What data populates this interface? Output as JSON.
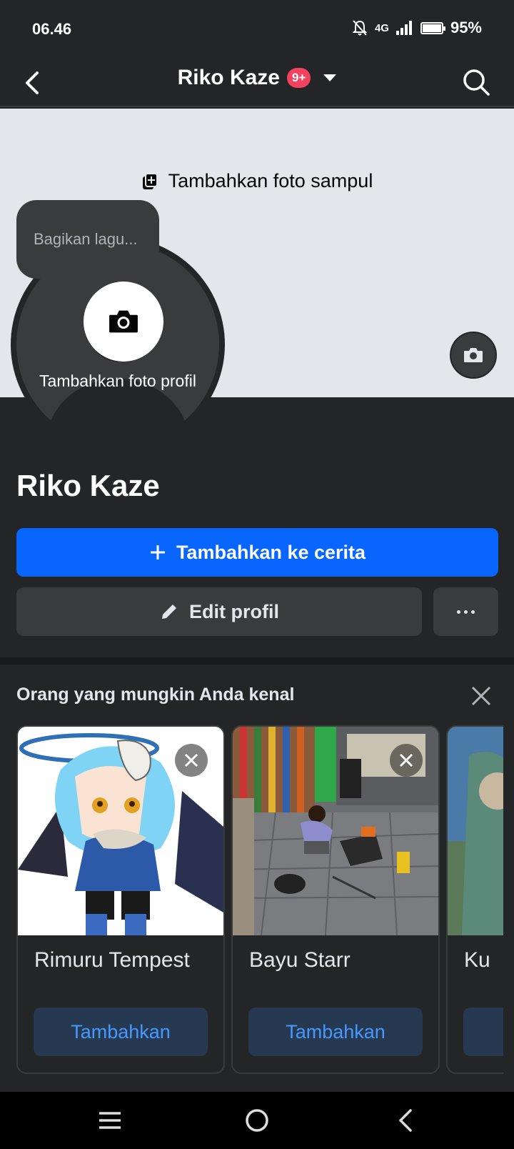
{
  "status_bar": {
    "time": "06.46",
    "network": "4G",
    "battery": "95%"
  },
  "header": {
    "title": "Riko Kaze",
    "badge": "9+"
  },
  "cover": {
    "add_cover_label": "Tambahkan foto sampul"
  },
  "tooltip": {
    "text": "Bagikan lagu..."
  },
  "profile_pic": {
    "label": "Tambahkan foto profil"
  },
  "profile": {
    "name": "Riko Kaze"
  },
  "actions": {
    "story_label": "Tambahkan ke cerita",
    "edit_label": "Edit profil"
  },
  "pymk": {
    "title": "Orang yang mungkin Anda kenal",
    "cards": [
      {
        "name": "Rimuru Tempest",
        "button": "Tambahkan"
      },
      {
        "name": "Bayu Starr",
        "button": "Tambahkan"
      },
      {
        "name": "Ku",
        "button": ""
      }
    ]
  },
  "colors": {
    "accent": "#0866ff",
    "background": "#242526",
    "secondary_button": "#3a3b3c",
    "add_button_bg": "#263951",
    "add_button_text": "#4599ff"
  },
  "icons": [
    "back-arrow-icon",
    "search-icon",
    "add-photo-icon",
    "camera-icon",
    "pencil-icon",
    "more-icon",
    "close-icon",
    "menu-icon",
    "home-circle-icon"
  ]
}
